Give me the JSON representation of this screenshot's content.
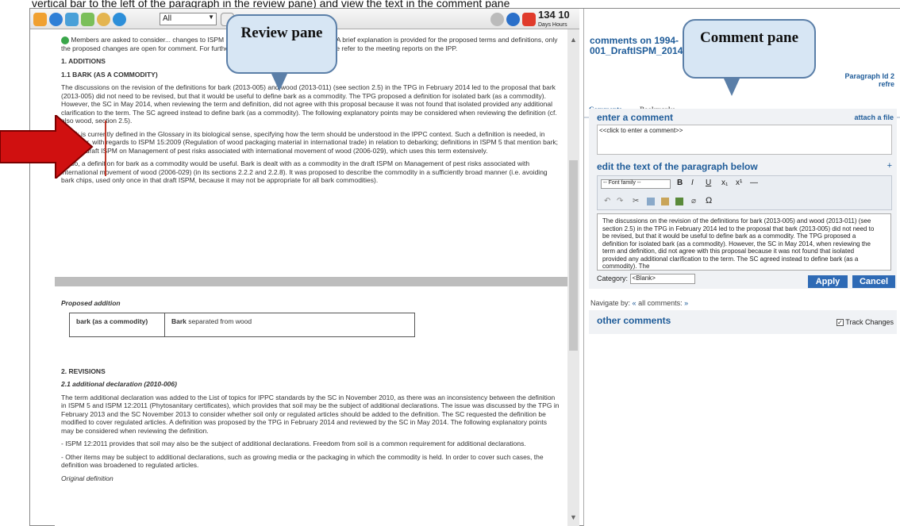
{
  "caption": "vertical bar to the left of the paragraph in the review pane) and view the text in the comment pane",
  "toolbar": {
    "filter_value": "All",
    "days": "134",
    "hours": "10",
    "days_label": "Days",
    "hours_label": "Hours",
    "icons": [
      "home-icon",
      "info-icon",
      "edit-icon",
      "tag-icon",
      "search-icon",
      "refresh-icon",
      "settings-icon",
      "help-icon",
      "exit-icon"
    ]
  },
  "callouts": {
    "review": "Review pane",
    "comment": "Comment pane"
  },
  "review": {
    "intro": "Members are asked to consider... changes to ISPM 5 (Glossary of Phytosanitary Terms). A brief explanation is provided for the proposed terms and definitions, only the proposed changes are open for comment. For further details on the specific terms, please refer to the meeting reports on the IPP.",
    "h_additions": "1. ADDITIONS",
    "h_bark": "1.1 BARK (AS A COMMODITY)",
    "p1": "The discussions on the revision of the definitions for bark (2013-005) and wood (2013-011) (see section 2.5) in the TPG in February 2014 led to the proposal that bark (2013-005) did not need to be revised, but that it would be useful to define bark as a commodity. The TPG proposed a definition for isolated bark (as a commodity). However, the SC in May 2014, when reviewing the term and definition, did not agree with this proposal because it was not found that isolated provided any additional clarification to the term. The SC agreed instead to define bark (as a commodity). The following explanatory points may be considered when reviewing the definition (cf. also wood, section 2.5).",
    "p2": "- Bark is currently defined in the Glossary in its biological sense, specifying how the term should be understood in the IPPC context. Such a definition is needed, in particular, with regards to ISPM 15:2009 (Regulation of wood packaging material in international trade) in relation to debarking; definitions in ISPM 5 that mention bark; and the draft ISPM on Management of pest risks associated with international movement of wood (2006-029), which uses this term extensively.",
    "p3": "- Also, a definition for bark as a commodity would be useful. Bark is dealt with as a commodity in the draft ISPM on Management of pest risks associated with international movement of wood (2006-029) (in its sections 2.2.2 and 2.2.8). It was proposed to describe the commodity in a sufficiently broad manner (i.e. avoiding bark chips, used only once in that draft ISPM, because it may not be appropriate for all bark commodities).",
    "proposed_addition": "Proposed addition",
    "table": {
      "term": "bark (as a commodity)",
      "def_bold": "Bark",
      "def_rest": " separated from wood"
    },
    "h_revisions": "2. REVISIONS",
    "h_addl": "2.1 additional declaration (2010-006)",
    "p4": "The term additional declaration was added to the List of topics for IPPC standards by the SC in November 2010, as there was an inconsistency between the definition in ISPM 5 and ISPM 12:2011 (Phytosanitary certificates), which provides that soil may be the subject of additional declarations. The issue was discussed by the TPG in February 2013 and the SC November 2013 to consider whether soil only or regulated articles should be added to the definition. The SC requested the definition be modified to cover regulated articles. A definition was proposed by the TPG in February 2014 and reviewed by the SC in May 2014. The following explanatory points may be considered when reviewing the definition.",
    "p5": "- ISPM 12:2011 provides that soil may also be the subject of additional declarations. Freedom from soil is a common requirement for additional declarations.",
    "p6": "- Other items may be subject to additional declarations, such as growing media or the packaging in which the commodity is held. In order to cover such cases, the definition was broadened to regulated articles.",
    "original_definition": "Original definition"
  },
  "comment_pane": {
    "title": "comments on 1994-001_DraftISPM_2014_...-25_IntoOCS.doc",
    "title_extra": "6-",
    "paragraph_id": "Paragraph Id 2",
    "refresh": "refre",
    "tabs": [
      "Comments",
      "Bookmarks"
    ],
    "enter_comment": "enter a comment",
    "attach": "attach a file",
    "comment_placeholder": "<<click to enter a comment>>",
    "edit_heading": "edit the text of the paragraph below",
    "plus": "+",
    "font_family": "-- Font family --",
    "editor_text": "The discussions on the revision of the definitions for bark (2013-005) and wood (2013-011) (see section 2.5) in the TPG in February 2014 led to the proposal that bark (2013-005) did not need to be revised, but that it would be useful to define bark as a commodity. The TPG proposed a definition for isolated bark (as a commodity). However, the SC in May 2014, when reviewing the term and definition, did not agree with this proposal because it was not found that isolated provided any additional clarification to the term. The SC agreed instead to define bark (as a commodity). The",
    "category_label": "Category:",
    "category_value": "<Blank>",
    "apply": "Apply",
    "cancel": "Cancel",
    "navigate_label": "Navigate by:",
    "prev": "«",
    "all_comments": "all comments:",
    "next": "»",
    "other_comments": "other comments",
    "track_changes": "Track Changes"
  },
  "colors": {
    "accent": "#1f5c99",
    "button": "#2e6ab5",
    "arrow": "#d01010"
  }
}
